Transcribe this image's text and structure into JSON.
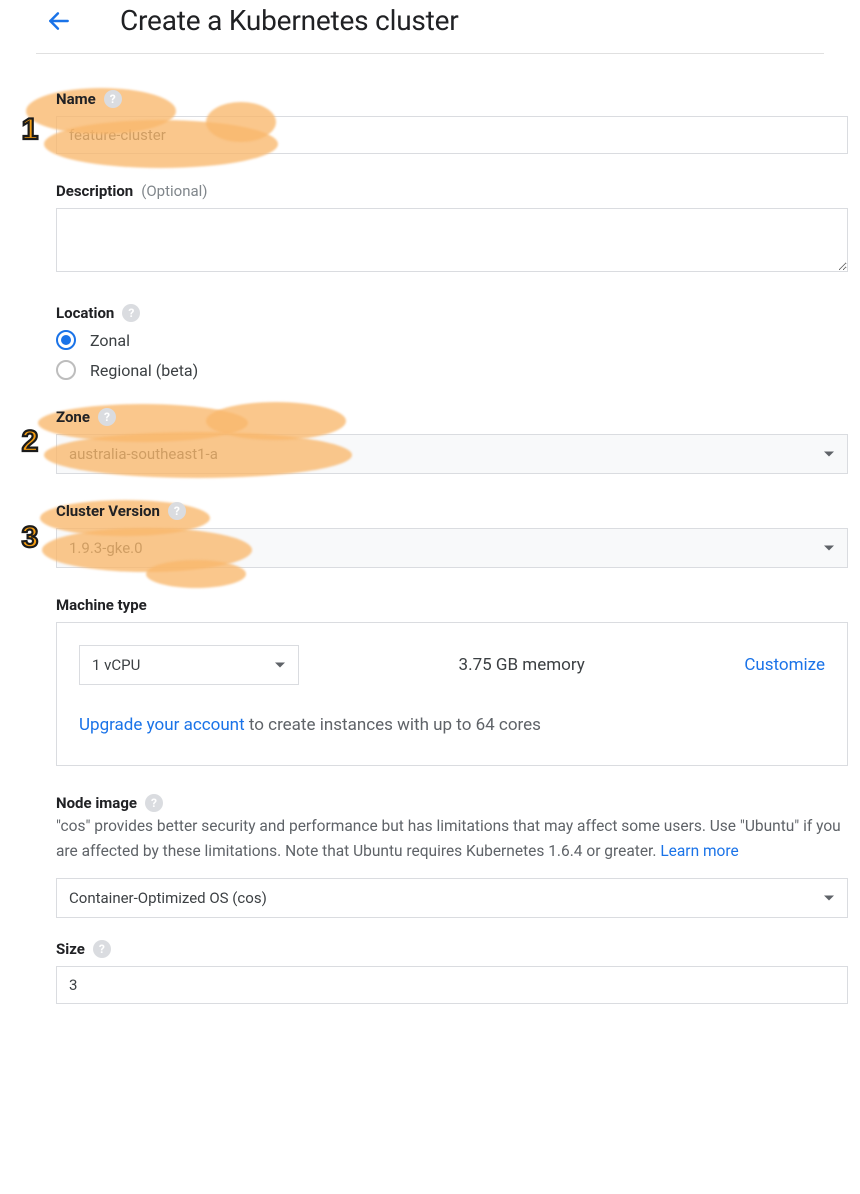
{
  "header": {
    "title": "Create a Kubernetes cluster"
  },
  "fields": {
    "name": {
      "label": "Name",
      "value": "feature-cluster"
    },
    "description": {
      "label": "Description",
      "optional": "(Optional)",
      "value": ""
    },
    "location": {
      "label": "Location",
      "options": {
        "zonal": "Zonal",
        "regional": "Regional (beta)"
      },
      "selected": "zonal"
    },
    "zone": {
      "label": "Zone",
      "value": "australia-southeast1-a"
    },
    "clusterVersion": {
      "label": "Cluster Version",
      "value": "1.9.3-gke.0"
    },
    "machineType": {
      "label": "Machine type",
      "vcpu": "1 vCPU",
      "memory": "3.75 GB memory",
      "customize": "Customize",
      "upgradeLink": "Upgrade your account",
      "upgradeRest": " to create instances with up to 64 cores"
    },
    "nodeImage": {
      "label": "Node image",
      "desc1": "\"cos\" provides better security and performance but has limitations that may affect some users. Use \"Ubuntu\" if you are affected by these limitations. Note that Ubuntu requires Kubernetes 1.6.4 or greater. ",
      "learn": "Learn more",
      "value": "Container-Optimized OS (cos)"
    },
    "size": {
      "label": "Size",
      "value": "3"
    }
  },
  "callouts": {
    "n1": "1",
    "n2": "2",
    "n3": "3"
  }
}
